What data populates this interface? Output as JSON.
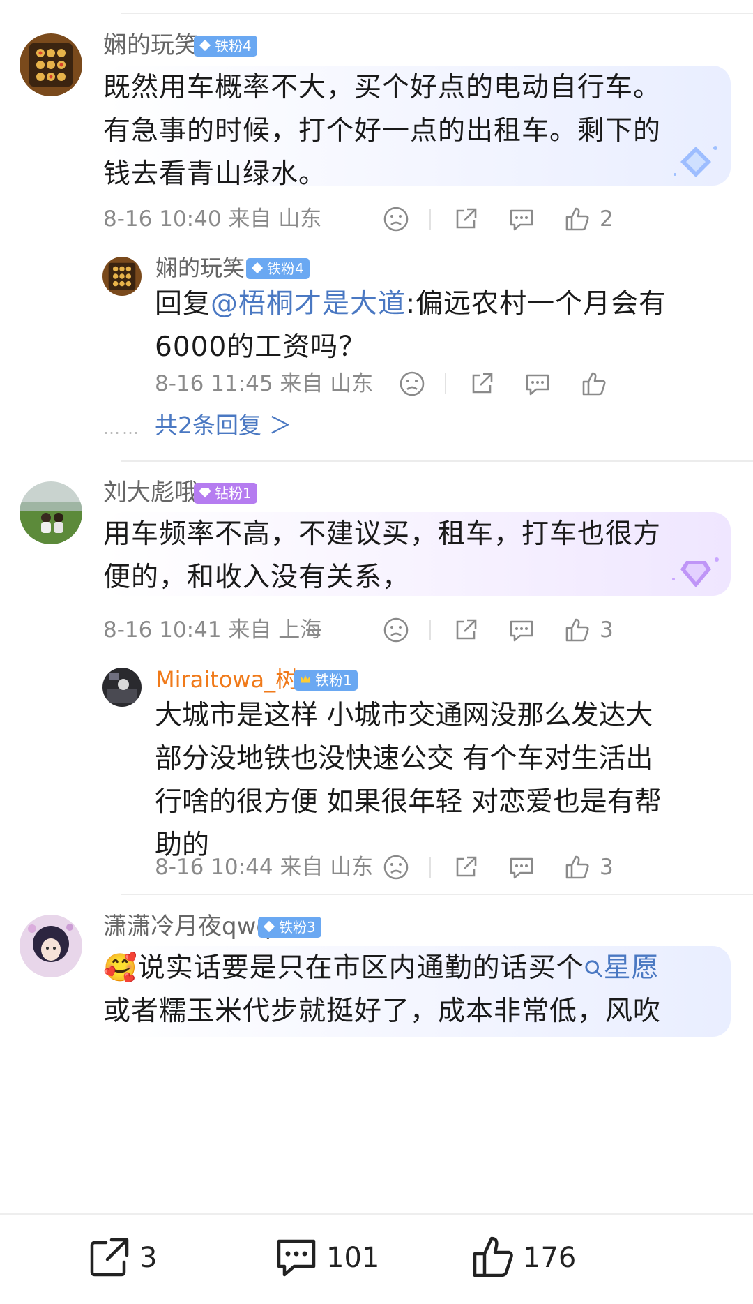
{
  "comments": [
    {
      "user": "娴的玩笑",
      "badge": "铁粉4",
      "text": "既然用车概率不大，买个好点的电动自行车。有急事的时候，打个好一点的出租车。剩下的钱去看青山绿水。",
      "lines": [
        "既然用车概率不大，买个好点的电动自行车。",
        "有急事的时候，打个好一点的出租车。剩下的",
        "钱去看青山绿水。"
      ],
      "meta": "8-16 10:40 来自 山东",
      "likes": "2",
      "reply": {
        "user": "娴的玩笑",
        "badge": "铁粉4",
        "prefix": "回复",
        "mention": "@梧桐才是大道",
        "line1_rest": ":偏远农村一个月会有",
        "line2": "6000的工资吗？",
        "meta": "8-16 11:45 来自 山东"
      },
      "more": "共2条回复 ＞",
      "dots": "……"
    },
    {
      "user": "刘大彪哦",
      "badge": "钻粉1",
      "lines": [
        "用车频率不高，不建议买，租车，打车也很方",
        "便的，和收入没有关系，"
      ],
      "meta": "8-16 10:41 来自 上海",
      "likes": "3",
      "reply": {
        "user": "Miraitowa_树",
        "badge": "铁粉1",
        "lines": [
          "大城市是这样 小城市交通网没那么发达大",
          "部分没地铁也没快速公交 有个车对生活出",
          "行啥的很方便 如果很年轻 对恋爱也是有帮",
          "助的"
        ],
        "meta": "8-16 10:44 来自 山东",
        "likes": "3"
      }
    },
    {
      "user": "潇潇冷月夜qwq",
      "badge": "铁粉3",
      "emoji": "🥰",
      "line1": "说实话要是只在市区内通勤的话买个",
      "tag": "星愿",
      "line2": "或者糯玉米代步就挺好了，成本非常低，风吹"
    }
  ],
  "bottom": {
    "share": "3",
    "comments": "101",
    "likes": "176"
  },
  "colors": {
    "link": "#4a78c2",
    "badge_iron": "#6aa8f2",
    "badge_diamond": "#b57cf0",
    "orange_name": "#f07a1a"
  }
}
